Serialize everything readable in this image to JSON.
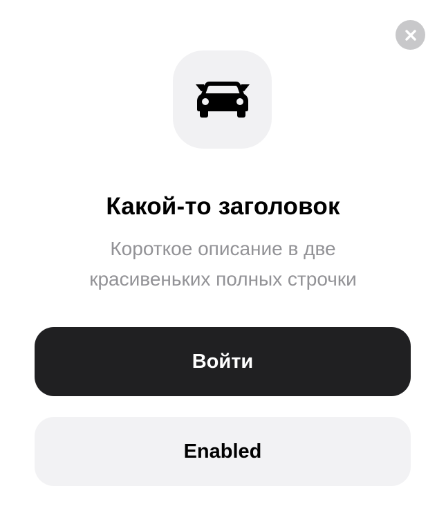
{
  "dialog": {
    "close_icon": "close-icon",
    "hero_icon": "car-icon",
    "title": "Какой-то заголовок",
    "description_lines": [
      "Короткое описание в две",
      "красивеньких полных строчки"
    ],
    "primary_button_label": "Войти",
    "secondary_button_label": "Enabled"
  },
  "colors": {
    "primary_button": "#202022",
    "secondary_button": "#f2f2f4",
    "icon_tile": "#f1f1f3",
    "close_button": "#c8c8ca",
    "description_text": "#929296"
  }
}
